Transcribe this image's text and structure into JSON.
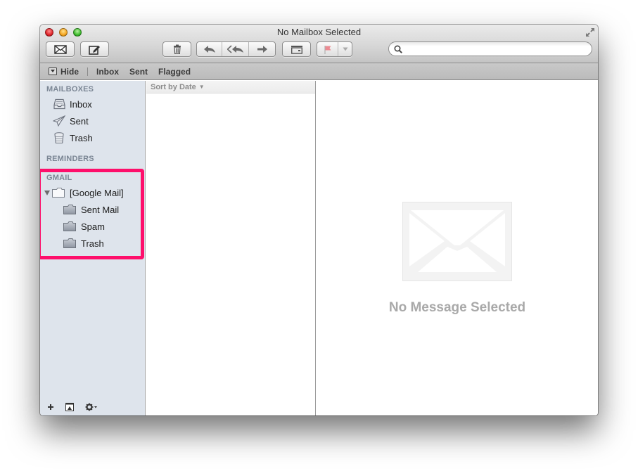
{
  "window": {
    "title": "No Mailbox Selected"
  },
  "toolbar": {
    "get_mail_icon": "envelope-icon",
    "compose_icon": "compose-icon",
    "delete_icon": "trash-icon",
    "reply_icon": "reply-icon",
    "reply_all_icon": "reply-all-icon",
    "forward_icon": "forward-icon",
    "archive_icon": "archive-icon",
    "flag_icon": "flag-icon",
    "flag_color": "#e8505b",
    "search": {
      "value": "",
      "placeholder": ""
    }
  },
  "favorites": {
    "hide_label": "Hide",
    "items": [
      "Inbox",
      "Sent",
      "Flagged"
    ]
  },
  "sidebar": {
    "mailboxes_header": "MAILBOXES",
    "mailboxes": [
      {
        "label": "Inbox",
        "icon": "inbox-tray-icon"
      },
      {
        "label": "Sent",
        "icon": "paper-plane-icon"
      },
      {
        "label": "Trash",
        "icon": "trash-can-icon"
      }
    ],
    "reminders_header": "REMINDERS",
    "gmail_header": "GMAIL",
    "gmail_root": {
      "label": "[Google Mail]",
      "expanded": true
    },
    "gmail_folders": [
      {
        "label": "Sent Mail"
      },
      {
        "label": "Spam"
      },
      {
        "label": "Trash"
      }
    ],
    "highlight_color": "#fe0f6b"
  },
  "message_list": {
    "sort_label": "Sort by Date"
  },
  "viewer": {
    "empty_text": "No Message Selected"
  }
}
